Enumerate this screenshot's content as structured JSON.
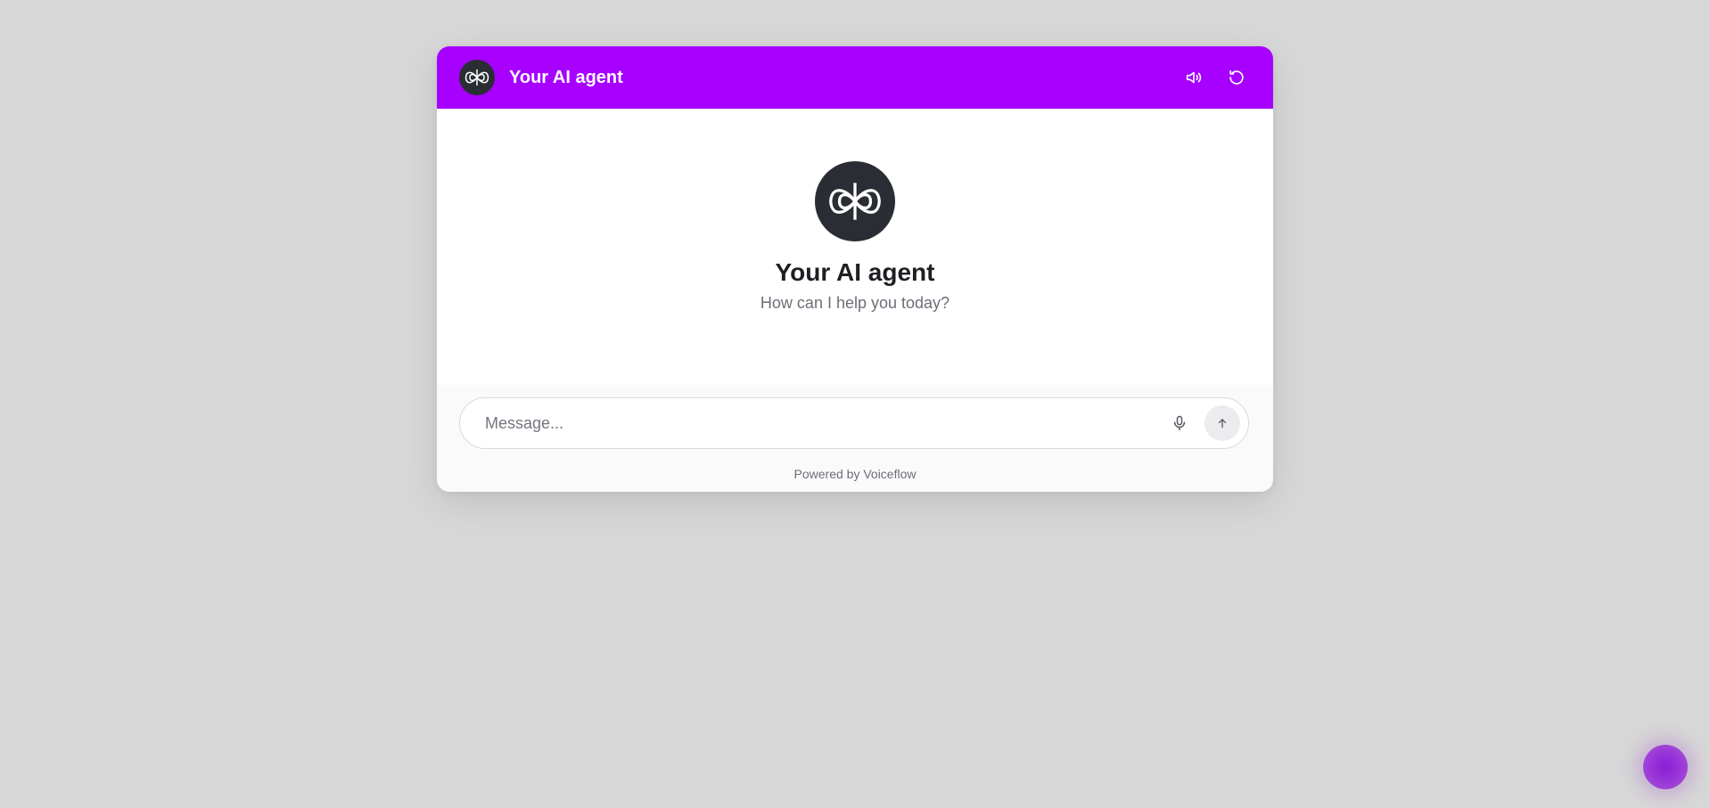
{
  "colors": {
    "brand": "#a700ff",
    "launcher": "#8a1fd6",
    "avatar_bg": "#2a2d33"
  },
  "header": {
    "title": "Your AI agent",
    "avatar_icon": "voiceflow-logo-icon",
    "sound_icon": "speaker-volume-icon",
    "restart_icon": "restart-icon"
  },
  "welcome": {
    "title": "Your AI agent",
    "subtitle": "How can I help you today?",
    "avatar_icon": "voiceflow-logo-icon"
  },
  "composer": {
    "placeholder": "Message...",
    "mic_icon": "microphone-icon",
    "send_icon": "arrow-up-icon"
  },
  "footer": {
    "powered_by": "Powered by Voiceflow"
  },
  "launcher": {
    "icon": "chat-launcher-icon"
  }
}
